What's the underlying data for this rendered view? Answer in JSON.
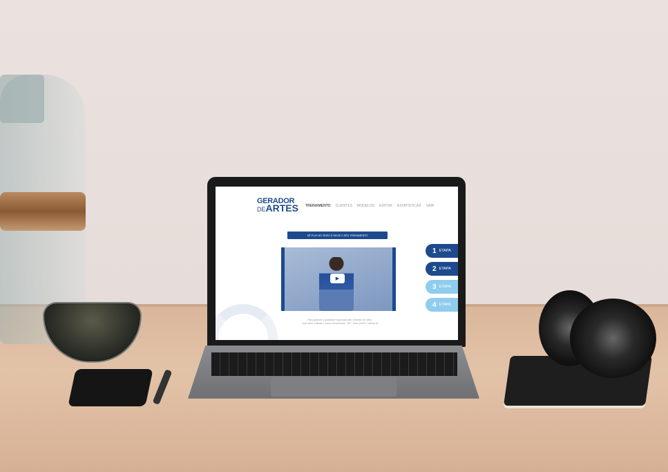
{
  "site": {
    "logo_line1": "GERADOR",
    "logo_de": "DE",
    "logo_line2": "ARTES",
    "nav": [
      "TREINAMENTO",
      "CLIENTES",
      "MODELOS",
      "EDITOR",
      "ESTATÍSTICAS",
      "SAIR"
    ],
    "active_nav": "TREINAMENTO",
    "banner": "DÊ PLAY NO VÍDEO E INICIE O SEU TREINAMENTO",
    "steps": [
      {
        "number": "1",
        "label": "ETAPA",
        "color": "#1d4a8c"
      },
      {
        "number": "2",
        "label": "ETAPA",
        "color": "#1d4a8c"
      },
      {
        "number": "3",
        "label": "ETAPA",
        "color": "#8fcdee"
      },
      {
        "number": "4",
        "label": "ETAPA",
        "color": "#8fcdee"
      }
    ],
    "caption_line1": "Para garantir a qualidade esperada pelo Gerador de Artes,",
    "caption_line2": "você deve realizar o nosso treinamento. OK? Tudo pronto? Vamos lá",
    "brand_color": "#1d4a8c",
    "play_icon": "play-icon"
  }
}
